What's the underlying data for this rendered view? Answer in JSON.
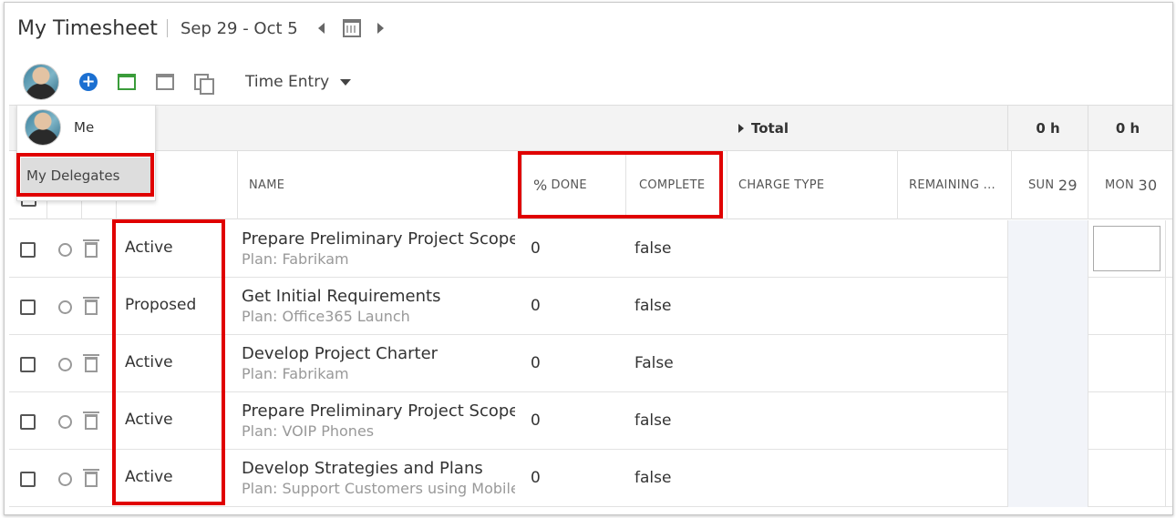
{
  "header": {
    "title": "My Timesheet",
    "date_range": "Sep 29 - Oct 5"
  },
  "toolbar": {
    "add_icon": "plus-circle-icon",
    "view_label": "Time Entry"
  },
  "user_menu": {
    "me_label": "Me",
    "delegates_label": "My Delegates"
  },
  "totals": {
    "label": "Total",
    "sun": "0 h",
    "mon": "0 h"
  },
  "columns": {
    "name": "NAME",
    "pct_symbol": "%",
    "pct_done": "DONE",
    "complete": "COMPLETE",
    "charge_type": "CHARGE TYPE",
    "remaining": "REMAINING ...",
    "sun": "SUN",
    "sun_num": "29",
    "mon": "MON",
    "mon_num": "30"
  },
  "rows": [
    {
      "status": "Active",
      "name": "Prepare Preliminary Project Scope Statement",
      "plan": "Plan: Fabrikam",
      "pct": "0",
      "complete": "false"
    },
    {
      "status": "Proposed",
      "name": "Get Initial Requirements",
      "plan": "Plan: Office365 Launch",
      "pct": "0",
      "complete": "false"
    },
    {
      "status": "Active",
      "name": "Develop Project Charter",
      "plan": "Plan: Fabrikam",
      "pct": "0",
      "complete": "False"
    },
    {
      "status": "Active",
      "name": "Prepare Preliminary Project Scope Statement",
      "plan": "Plan: VOIP Phones",
      "pct": "0",
      "complete": "false"
    },
    {
      "status": "Active",
      "name": "Develop Strategies and Plans",
      "plan": "Plan: Support Customers using Mobile",
      "pct": "0",
      "complete": "false"
    }
  ],
  "colors": {
    "highlight": "#e00000",
    "accent_blue": "#1b6fd1",
    "accent_green": "#3a9c3a"
  }
}
